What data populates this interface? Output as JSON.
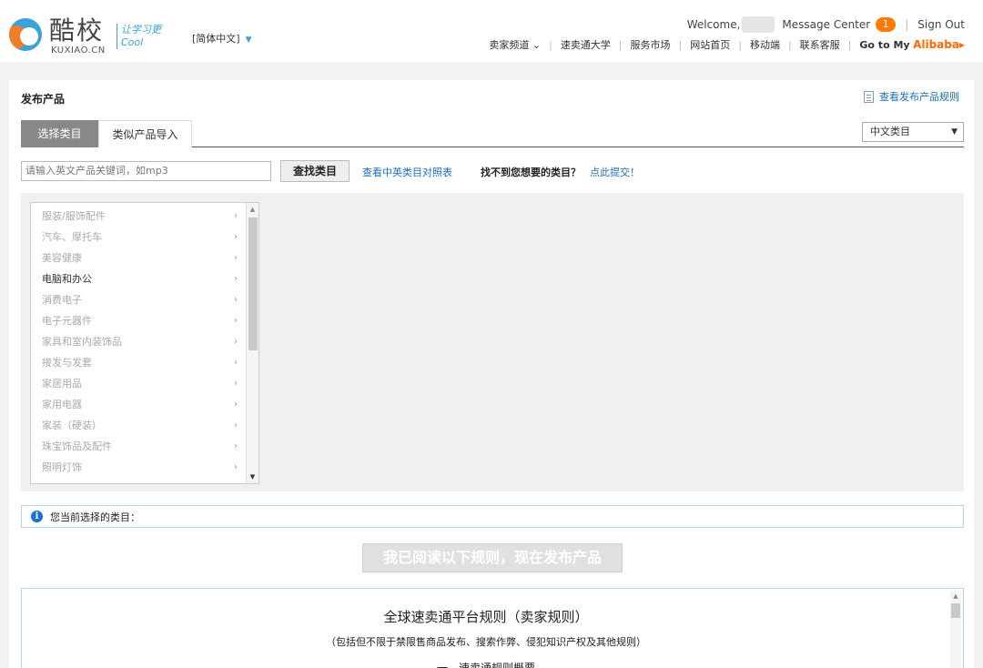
{
  "header": {
    "logo_cn": "酷校",
    "logo_en": "KUXIAO.CN",
    "slogan": "让学习更Cool",
    "language": "[简体中文]",
    "welcome": "Welcome,",
    "message_center": "Message Center",
    "message_count": "1",
    "sign_out": "Sign Out",
    "nav": {
      "seller_channel": "卖家频道",
      "university": "速卖通大学",
      "service_market": "服务市场",
      "home": "网站首页",
      "mobile": "移动端",
      "support": "联系客服",
      "goto": "Go to My",
      "alibaba": "Alibaba"
    }
  },
  "page": {
    "title": "发布产品",
    "rules_link": "查看发布产品规则",
    "tabs": [
      "选择类目",
      "类似产品导入"
    ],
    "category_language": "中文类目",
    "search_placeholder": "请输入英文产品关键词，如mp3",
    "search_button": "查找类目",
    "compare_link": "查看中英类目对照表",
    "not_found": "找不到您想要的类目？",
    "submit_link": "点此提交！",
    "categories": [
      {
        "label": "服装/服饰配件",
        "active": false
      },
      {
        "label": "汽车、摩托车",
        "active": false
      },
      {
        "label": "美容健康",
        "active": false
      },
      {
        "label": "电脑和办公",
        "active": true
      },
      {
        "label": "消费电子",
        "active": false
      },
      {
        "label": "电子元器件",
        "active": false
      },
      {
        "label": "家具和室内装饰品",
        "active": false
      },
      {
        "label": "接发与发套",
        "active": false
      },
      {
        "label": "家居用品",
        "active": false
      },
      {
        "label": "家用电器",
        "active": false
      },
      {
        "label": "家装（硬装）",
        "active": false
      },
      {
        "label": "珠宝饰品及配件",
        "active": false
      },
      {
        "label": "照明灯饰",
        "active": false
      }
    ],
    "current_category_label": "您当前选择的类目：",
    "publish_button": "我已阅读以下规则，现在发布产品",
    "rules": {
      "title": "全球速卖通平台规则（卖家规则）",
      "subtitle": "（包括但不限于禁限售商品发布、搜索作弊、侵犯知识产权及其他规则）",
      "next_line": "一、速卖通规则概要"
    }
  },
  "colors": {
    "link": "#1a6fc2",
    "badge": "#ff7a00",
    "alibaba": "#ff6a00",
    "tab_active": "#888888"
  }
}
